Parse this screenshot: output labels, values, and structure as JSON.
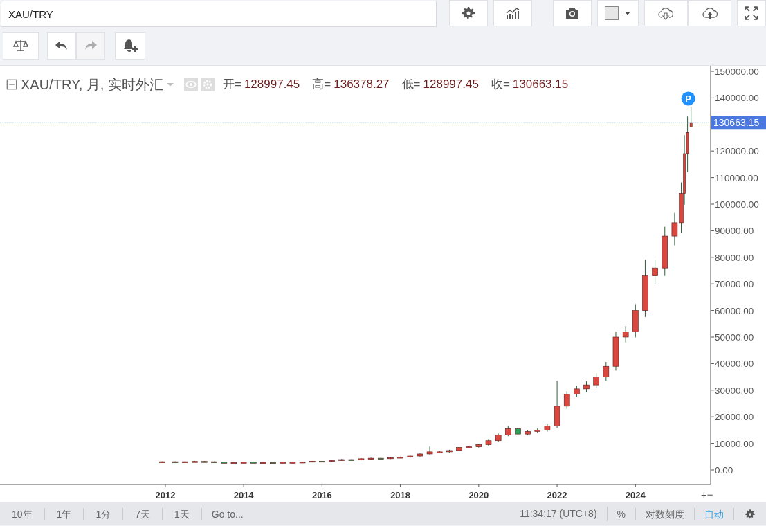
{
  "symbol_field": {
    "value": "XAU/TRY"
  },
  "legend": {
    "title": "XAU/TRY, 月, 实时外汇",
    "items": [
      {
        "label": "开=",
        "value": "128997.45"
      },
      {
        "label": "高=",
        "value": "136378.27"
      },
      {
        "label": "低=",
        "value": "128997.45"
      },
      {
        "label": "收=",
        "value": "130663.15"
      }
    ]
  },
  "marker": "P",
  "chart": {
    "chart_data": {
      "type": "candlestick",
      "xlim": [
        2007.78,
        2025.92
      ],
      "ylim": [
        -5470,
        152083
      ],
      "xticks": [
        {
          "value": 2012,
          "label": "2012"
        },
        {
          "value": 2014,
          "label": "2014"
        },
        {
          "value": 2016,
          "label": "2016"
        },
        {
          "value": 2018,
          "label": "2018"
        },
        {
          "value": 2020,
          "label": "2020"
        },
        {
          "value": 2022,
          "label": "2022"
        },
        {
          "value": 2024,
          "label": "2024"
        }
      ],
      "yticks": [
        {
          "value": 0,
          "label": "0.00"
        },
        {
          "value": 10000,
          "label": "10000.00"
        },
        {
          "value": 20000,
          "label": "20000.00"
        },
        {
          "value": 30000,
          "label": "30000.00"
        },
        {
          "value": 40000,
          "label": "40000.00"
        },
        {
          "value": 50000,
          "label": "50000.00"
        },
        {
          "value": 60000,
          "label": "60000.00"
        },
        {
          "value": 70000,
          "label": "70000.00"
        },
        {
          "value": 80000,
          "label": "80000.00"
        },
        {
          "value": 90000,
          "label": "90000.00"
        },
        {
          "value": 100000,
          "label": "100000.00"
        },
        {
          "value": 110000,
          "label": "110000.00"
        },
        {
          "value": 120000,
          "label": "120000.00"
        },
        {
          "value": 140000,
          "label": "140000.00"
        },
        {
          "value": 150000,
          "label": "150000.00"
        }
      ],
      "ref_lines": [
        {
          "axis": "y",
          "value": 130663.15,
          "label": "130663.15",
          "color": "#4a78e0"
        }
      ],
      "x": [
        2011.92,
        2012.25,
        2012.5,
        2012.75,
        2013.0,
        2013.25,
        2013.5,
        2013.75,
        2014.0,
        2014.25,
        2014.5,
        2014.75,
        2015.0,
        2015.25,
        2015.5,
        2015.75,
        2016.0,
        2016.25,
        2016.5,
        2016.75,
        2017.0,
        2017.25,
        2017.5,
        2017.75,
        2018.0,
        2018.25,
        2018.5,
        2018.75,
        2019.0,
        2019.25,
        2019.5,
        2019.75,
        2020.0,
        2020.25,
        2020.5,
        2020.75,
        2021.0,
        2021.25,
        2021.5,
        2021.75,
        2022.0,
        2022.25,
        2022.5,
        2022.75,
        2023.0,
        2023.25,
        2023.5,
        2023.75,
        2024.0,
        2024.25,
        2024.5,
        2024.75,
        2025.0,
        2025.17,
        2025.25,
        2025.33,
        2025.42
      ],
      "ohlc": [
        [
          3000,
          3200,
          2900,
          3100
        ],
        [
          3100,
          3200,
          2900,
          3000
        ],
        [
          3000,
          3200,
          2900,
          3100
        ],
        [
          3100,
          3300,
          3000,
          3200
        ],
        [
          3200,
          3300,
          3000,
          3100
        ],
        [
          3100,
          3200,
          2800,
          2900
        ],
        [
          2900,
          3000,
          2600,
          2700
        ],
        [
          2700,
          2900,
          2600,
          2800
        ],
        [
          2800,
          3000,
          2700,
          2900
        ],
        [
          2900,
          3000,
          2700,
          2800
        ],
        [
          2800,
          2900,
          2700,
          2800
        ],
        [
          2800,
          2900,
          2600,
          2700
        ],
        [
          2700,
          3000,
          2600,
          2900
        ],
        [
          2900,
          3000,
          2800,
          2900
        ],
        [
          2900,
          3100,
          2800,
          3000
        ],
        [
          3000,
          3400,
          2900,
          3300
        ],
        [
          3300,
          3400,
          3100,
          3200
        ],
        [
          3200,
          3700,
          3100,
          3600
        ],
        [
          3600,
          4100,
          3500,
          3900
        ],
        [
          3900,
          4000,
          3700,
          3800
        ],
        [
          3800,
          4400,
          3700,
          4200
        ],
        [
          4200,
          4600,
          4000,
          4400
        ],
        [
          4400,
          4500,
          4100,
          4300
        ],
        [
          4300,
          4800,
          4100,
          4600
        ],
        [
          4600,
          5000,
          4400,
          4800
        ],
        [
          4800,
          5400,
          4600,
          5200
        ],
        [
          5200,
          6200,
          5000,
          6000
        ],
        [
          6000,
          8800,
          5800,
          6800
        ],
        [
          6800,
          7100,
          6500,
          6800
        ],
        [
          6800,
          7600,
          6500,
          7300
        ],
        [
          7300,
          8800,
          7000,
          8500
        ],
        [
          8500,
          9000,
          8200,
          8700
        ],
        [
          8700,
          9900,
          8400,
          9500
        ],
        [
          9500,
          11400,
          9100,
          11000
        ],
        [
          11000,
          13700,
          10600,
          13200
        ],
        [
          13200,
          16500,
          12700,
          15500
        ],
        [
          15500,
          15900,
          13000,
          13500
        ],
        [
          13500,
          15100,
          13000,
          14500
        ],
        [
          14500,
          15600,
          13900,
          15000
        ],
        [
          15000,
          17200,
          14400,
          16500
        ],
        [
          16500,
          33500,
          15800,
          24000
        ],
        [
          24000,
          29600,
          23000,
          28500
        ],
        [
          28500,
          31700,
          27400,
          30500
        ],
        [
          30500,
          33300,
          29300,
          32000
        ],
        [
          32000,
          36400,
          30700,
          35000
        ],
        [
          35000,
          40600,
          33600,
          39000
        ],
        [
          39000,
          52000,
          37400,
          50000
        ],
        [
          50000,
          54100,
          48000,
          52000
        ],
        [
          52000,
          62400,
          49900,
          60000
        ],
        [
          60000,
          79000,
          57600,
          73000
        ],
        [
          73000,
          79000,
          70100,
          76000
        ],
        [
          76000,
          91500,
          73000,
          88000
        ],
        [
          88000,
          96700,
          84500,
          93000
        ],
        [
          93000,
          108200,
          89300,
          104000
        ],
        [
          104000,
          126000,
          99800,
          119000
        ],
        [
          119000,
          133000,
          112000,
          127000
        ],
        [
          129000,
          136400,
          129000,
          130700
        ]
      ]
    }
  },
  "axis_zoom": "+−",
  "footer": {
    "ranges": [
      "10年",
      "1年",
      "1分",
      "7天",
      "1天"
    ],
    "goto": "Go to...",
    "time": "11:34:17 (UTC+8)",
    "options": [
      {
        "label": "%",
        "selected": false
      },
      {
        "label": "对数刻度",
        "selected": false
      },
      {
        "label": "自动",
        "selected": true
      }
    ]
  }
}
